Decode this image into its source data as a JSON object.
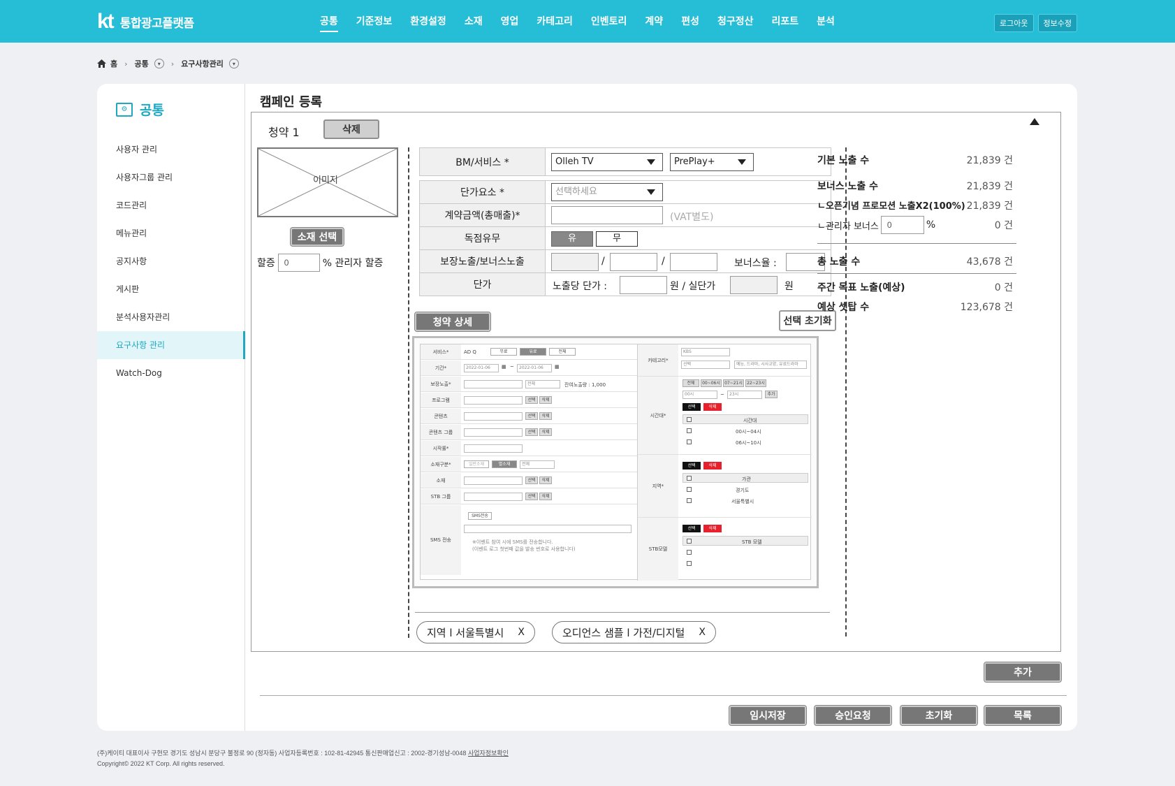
{
  "app": {
    "logo": "kt",
    "title": "통합광고플랫폼"
  },
  "nav": [
    {
      "label": "공통",
      "active": true
    },
    {
      "label": "기준정보"
    },
    {
      "label": "환경설정"
    },
    {
      "label": "소재"
    },
    {
      "label": "영업"
    },
    {
      "label": "카테고리"
    },
    {
      "label": "인벤토리"
    },
    {
      "label": "계약"
    },
    {
      "label": "편성"
    },
    {
      "label": "청구정산"
    },
    {
      "label": "리포트"
    },
    {
      "label": "분석"
    }
  ],
  "top_buttons": {
    "logout": "로그아웃",
    "edit_info": "정보수정"
  },
  "breadcrumb": {
    "home": "홈",
    "level1": "공통",
    "level2": "요구사항관리"
  },
  "sidebar": {
    "title": "공통",
    "items": [
      {
        "label": "사용자 관리"
      },
      {
        "label": "사용자그룹 관리"
      },
      {
        "label": "코드관리"
      },
      {
        "label": "메뉴관리"
      },
      {
        "label": "공지사항"
      },
      {
        "label": "게시판"
      },
      {
        "label": "분석사용자관리"
      },
      {
        "label": "요구사항 관리",
        "active": true
      },
      {
        "label": "Watch-Dog"
      }
    ]
  },
  "page": {
    "title": "캠페인 등록"
  },
  "contract": {
    "title": "청약 1",
    "delete_label": "삭제",
    "image_label": "이미지",
    "select_material_label": "소재 선택",
    "discount_label": "할증",
    "discount_value": "0",
    "discount_suffix": "% 관리자 할증"
  },
  "form": {
    "bm_label": "BM/서비스 *",
    "bm_value": "Olleh TV",
    "bm_sub_value": "PrePlay+",
    "unit_label": "단가요소 *",
    "unit_placeholder": "선택하세요",
    "amount_label": "계약금액(총매출)*",
    "vat_note": "(VAT별도)",
    "exclusive_label": "독점유무",
    "exclusive_yes": "유",
    "exclusive_no": "무",
    "guarantee_label": "보장노출/보너스노출",
    "slash": "/",
    "bonus_rate_label": "보너스율 :",
    "price_label": "단가",
    "per_exposure_label": "노출당 단가 :",
    "won_real_label": "원 / 실단가",
    "won_label": "원"
  },
  "detail_button": "청약 상세",
  "reset_selection_button": "선택 초기화",
  "summary": {
    "base_label": "기본 노출 수",
    "base_value": "21,839 건",
    "bonus_label": "보너스 노출 수",
    "bonus_value": "21,839 건",
    "promo_label": "ㄴ오픈기념 프로모션 노출X2(100%)",
    "promo_value": "21,839 건",
    "admin_bonus_label": "ㄴ관리자 보너스",
    "admin_bonus_input": "0",
    "admin_bonus_pct": "%",
    "admin_bonus_value": "0 건",
    "total_label": "총 노출 수",
    "total_value": "43,678 건",
    "weekly_label": "주간 목표 노출(예상)",
    "weekly_value": "0 건",
    "settop_label": "예상 셋탑 수",
    "settop_value": "123,678 건"
  },
  "mini": {
    "service": "서비스*",
    "service_value": "AD Q",
    "opt_free": "무료",
    "opt_paid": "유료",
    "opt_all": "전체",
    "period": "기간*",
    "date_from": "2022-01-06",
    "date_to": "2022-01-06",
    "tilde": "~",
    "guarantee": "보장노출*",
    "all": "전체",
    "remaining": "잔여노출량 : 1,000",
    "program": "프로그램",
    "content": "콘텐츠",
    "content_group": "콘텐츠 그룹",
    "viewing_rate": "시작률*",
    "material_type": "소재구분*",
    "normal_material": "일반소재",
    "special_material": "별소재",
    "material": "소재",
    "stb_group": "STB 그룹",
    "sms": "SMS 전송",
    "sms_btn": "SMS전송",
    "sms_note1": "※이벤트 참여 시에 SMS를 전송합니다.",
    "sms_note2": "(이벤트 로그 첫번째 값을 발송 번호로 사용합니다)",
    "select": "선택",
    "delete": "삭제",
    "add": "추가",
    "category": "카테고리*",
    "cat_value": "KBS",
    "cat_select": "선택",
    "cat_tags": "예능, 드라마, 시사교양, 유료드라마",
    "time": "시간대*",
    "t_all": "전체",
    "t1": "00~06시",
    "t2": "07~21시",
    "t3": "22~23시",
    "time_from": "00시",
    "time_to": "23시",
    "time_header": "시간대",
    "time_r1": "00시~04시",
    "time_r2": "06시~10시",
    "region": "지역*",
    "region_header": "가관",
    "region_r1": "경기도",
    "region_r2": "서울특별시",
    "stb_model": "STB모델",
    "stb_header": "STB 모델"
  },
  "chips": [
    {
      "label": "지역 l 서울특별시",
      "x": "X"
    },
    {
      "label": "오디언스 샘플 l 가전/디지털",
      "x": "X"
    }
  ],
  "buttons": {
    "add": "추가",
    "temp_save": "임시저장",
    "approve": "승인요청",
    "reset": "초기화",
    "list": "목록"
  },
  "footer": {
    "line1": "(주)케이티 대표이사 구현모 경기도 성남시 분당구 불정로 90 (정자동) 사업자등록번호 : 102-81-42945 통신판매업신고 : 2002-경기성남-0048",
    "privacy": "사업자정보확인",
    "line2": "Copyright© 2022 KT Corp. All rights reserved."
  }
}
